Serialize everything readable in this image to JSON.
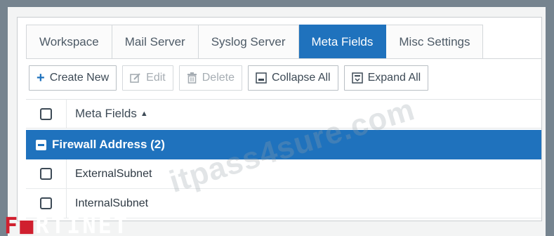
{
  "tabs": [
    {
      "label": "Workspace",
      "active": false
    },
    {
      "label": "Mail Server",
      "active": false
    },
    {
      "label": "Syslog Server",
      "active": false
    },
    {
      "label": "Meta Fields",
      "active": true
    },
    {
      "label": "Misc Settings",
      "active": false
    }
  ],
  "toolbar": {
    "create_label": "Create New",
    "edit_label": "Edit",
    "delete_label": "Delete",
    "collapse_label": "Collapse All",
    "expand_label": "Expand All"
  },
  "table": {
    "header": "Meta Fields",
    "group": {
      "label": "Firewall Address (2)"
    },
    "rows": [
      {
        "name": "ExternalSubnet"
      },
      {
        "name": "InternalSubnet"
      }
    ]
  },
  "watermark": "itpass4sure.com",
  "logo": {
    "text_a": "F",
    "text_b": "RTINET"
  },
  "colors": {
    "accent": "#1f72bd",
    "logo_red": "#d0202f"
  }
}
